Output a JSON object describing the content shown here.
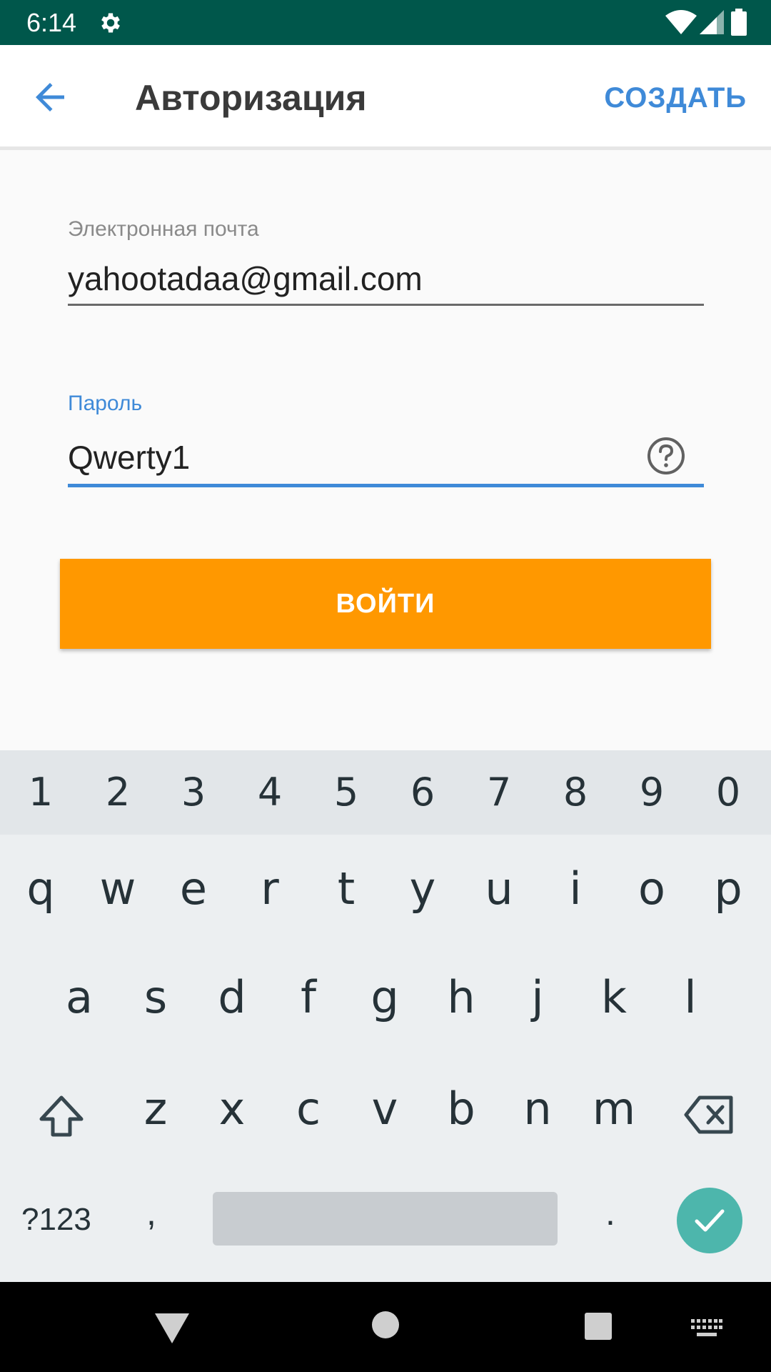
{
  "status_bar": {
    "time": "6:14",
    "icons": [
      "gear-icon",
      "wifi-icon",
      "cell-signal-icon",
      "battery-icon"
    ],
    "background": "#00574b"
  },
  "app_bar": {
    "back_icon": "arrow-back-icon",
    "title": "Авторизация",
    "create_label": "СОЗДАТЬ",
    "accent": "#3f8ad8"
  },
  "form": {
    "email": {
      "label": "Электронная почта",
      "value": "yahootadaa@gmail.com"
    },
    "password": {
      "label": "Пароль",
      "value": "Qwerty1",
      "help_icon": "help-circle-icon"
    },
    "login_label": "ВОЙТИ",
    "login_color": "#ff9800"
  },
  "keyboard": {
    "number_row": [
      "1",
      "2",
      "3",
      "4",
      "5",
      "6",
      "7",
      "8",
      "9",
      "0"
    ],
    "row1": [
      "q",
      "w",
      "e",
      "r",
      "t",
      "y",
      "u",
      "i",
      "o",
      "p"
    ],
    "row2": [
      "a",
      "s",
      "d",
      "f",
      "g",
      "h",
      "j",
      "k",
      "l"
    ],
    "row3": [
      "z",
      "x",
      "c",
      "v",
      "b",
      "n",
      "m"
    ],
    "symbols_label": "?123",
    "comma": ",",
    "period": ".",
    "shift_icon": "shift-icon",
    "backspace_icon": "backspace-icon",
    "done_icon": "check-icon",
    "done_color": "#4db6ac"
  },
  "nav_bar": {
    "icons": [
      "nav-back-icon",
      "nav-home-icon",
      "nav-recents-icon",
      "keyboard-switch-icon"
    ]
  }
}
